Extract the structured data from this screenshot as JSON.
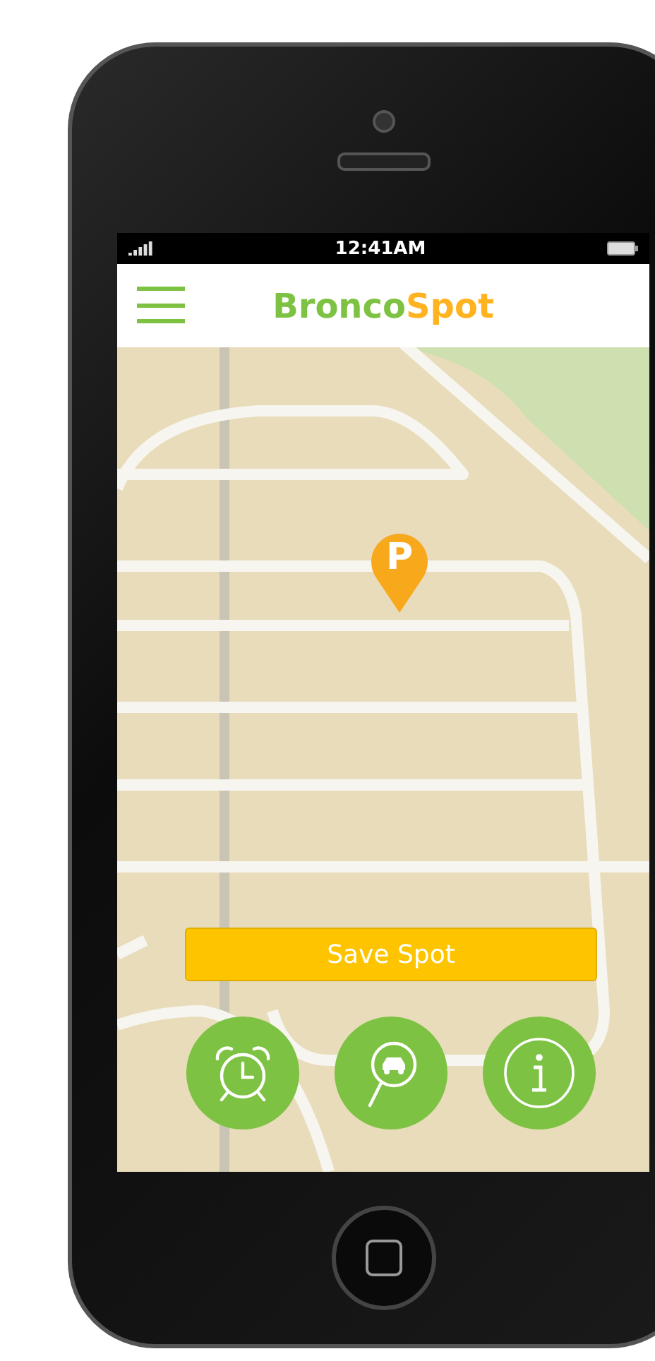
{
  "status_bar": {
    "time": "12:41AM"
  },
  "header": {
    "logo": [
      "Bronco",
      "Spot"
    ]
  },
  "map": {
    "pin_label": "P"
  },
  "save_button": {
    "label": "Save Spot"
  },
  "actions": [
    {
      "kind": "alarm"
    },
    {
      "kind": "car-search"
    },
    {
      "kind": "info"
    }
  ]
}
